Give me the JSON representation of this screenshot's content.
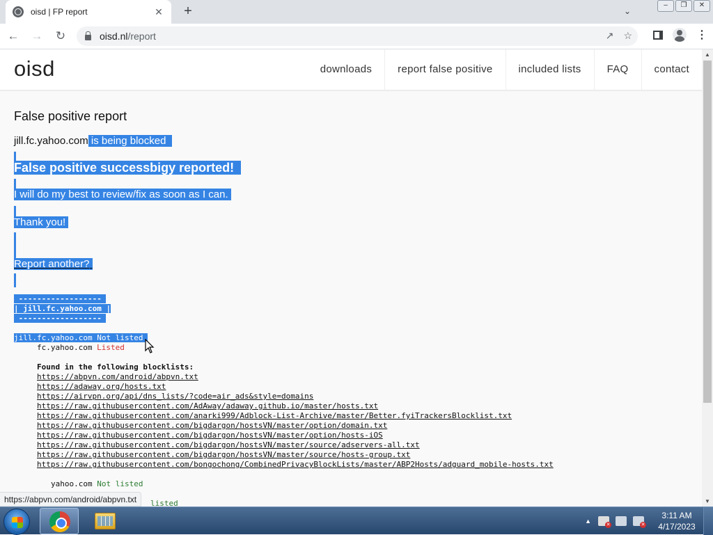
{
  "browser": {
    "tab_title": "oisd | FP report",
    "tab_close": "✕",
    "new_tab": "+",
    "url_host": "oisd.nl",
    "url_path": "/report",
    "status_url": "https://abpvn.com/android/abpvn.txt"
  },
  "site": {
    "logo": "oisd",
    "nav": [
      "downloads",
      "report false positive",
      "included lists",
      "FAQ",
      "contact"
    ]
  },
  "report": {
    "heading": "False positive report",
    "domain": "jill.fc.yahoo.com",
    "blocked_text": " is being blocked",
    "success": "False positive successbigy reported!",
    "best": "I will do my best to review/fix as soon as I can.",
    "thanks": "Thank you!",
    "another": "Report another?",
    "box_border": " ------------------ ",
    "box_line": "| jill.fc.yahoo.com |",
    "result_domain": "jill.fc.yahoo.com",
    "result_status": "Not listed",
    "sub_domain": "fc.yahoo.com",
    "sub_status": "Listed",
    "found_heading": "Found in the following blocklists:",
    "blocklists": [
      "https://abpvn.com/android/abpvn.txt",
      "https://adaway.org/hosts.txt",
      "https://airvpn.org/api/dns_lists/?code=air_ads&style=domains",
      "https://raw.githubusercontent.com/AdAway/adaway.github.io/master/hosts.txt",
      "https://raw.githubusercontent.com/anarki999/Adblock-List-Archive/master/Better.fyiTrackersBlocklist.txt",
      "https://raw.githubusercontent.com/bigdargon/hostsVN/master/option/domain.txt",
      "https://raw.githubusercontent.com/bigdargon/hostsVN/master/option/hosts-iOS",
      "https://raw.githubusercontent.com/bigdargon/hostsVN/master/source/adservers-all.txt",
      "https://raw.githubusercontent.com/bigdargon/hostsVN/master/source/hosts-group.txt",
      "https://raw.githubusercontent.com/bongochong/CombinedPrivacyBlockLists/master/ABP2Hosts/adguard_mobile-hosts.txt"
    ],
    "parent_domain": "yahoo.com",
    "parent_status": "Not listed",
    "partial_status": "listed"
  },
  "taskbar": {
    "time": "3:11 AM",
    "date": "4/17/2023"
  },
  "colors": {
    "selection": "#3584e4",
    "listed": "#d32f2f",
    "not_listed": "#2e7d32"
  }
}
